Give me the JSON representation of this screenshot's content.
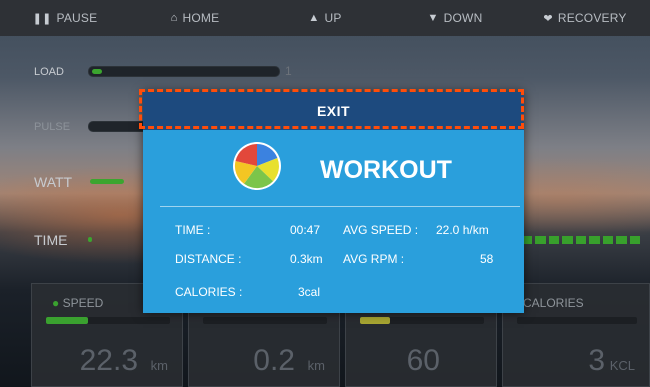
{
  "topbar": {
    "pause": "PAUSE",
    "home": "HOME",
    "up": "UP",
    "down": "DOWN",
    "recovery": "RECOVERY"
  },
  "rows": {
    "load": {
      "label": "LOAD",
      "value": "1"
    },
    "pulse": {
      "label": "PULSE"
    },
    "watt": {
      "label": "WATT"
    },
    "time": {
      "label": "TIME"
    }
  },
  "stats": {
    "speed": {
      "label": "SPEED",
      "value": "22.3",
      "unit": "km"
    },
    "distance": {
      "value": "0.2",
      "unit": "km"
    },
    "rpm": {
      "value": "60"
    },
    "calories": {
      "label": "CALORIES",
      "value": "3",
      "unit": "KCL"
    }
  },
  "popup": {
    "exit_label": "EXIT",
    "title": "WORKOUT",
    "time_label": "TIME :",
    "time_value": "00:47",
    "avg_speed_label": "AVG SPEED :",
    "avg_speed_value": "22.0 h/km",
    "distance_label": "DISTANCE :",
    "distance_value": "0.3km",
    "avg_rpm_label": "AVG RPM :",
    "avg_rpm_value": "58",
    "calories_label": "CALORIES :",
    "calories_value": "3cal"
  },
  "colors": {
    "popup_bg": "#2a9fdc",
    "exit_bg": "#1d4a7e",
    "highlight": "#ff4d0a",
    "progress_green": "#3aa12f"
  }
}
